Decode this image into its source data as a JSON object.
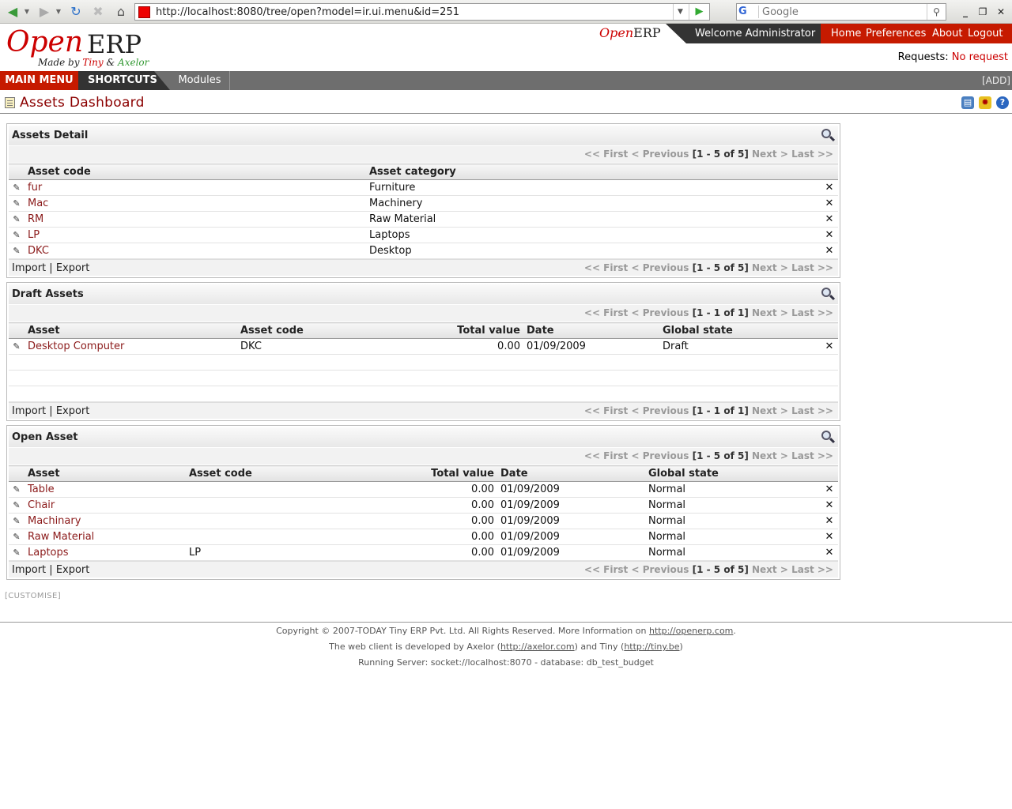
{
  "browser": {
    "url": "http://localhost:8080/tree/open?model=ir.ui.menu&id=251",
    "search_placeholder": "Google",
    "search_engine_icon": "G"
  },
  "header": {
    "logo_open": "Open",
    "logo_erp": "ERP",
    "logo_made_by": "Made by",
    "logo_tiny": "Tiny",
    "logo_amp": "&",
    "logo_axelor": "Axelor",
    "mini_logo_open": "Open",
    "mini_logo_erp": "ERP",
    "welcome": "Welcome Administrator",
    "links": {
      "home": "Home",
      "preferences": "Preferences",
      "about": "About",
      "logout": "Logout"
    },
    "requests_label": "Requests:",
    "requests_value": "No request"
  },
  "menubar": {
    "main_menu": "MAIN MENU",
    "shortcuts": "SHORTCUTS",
    "modules": "Modules",
    "add": "[ADD]"
  },
  "page": {
    "title": "Assets Dashboard"
  },
  "pager_labels": {
    "first": "<< First",
    "previous": "< Previous",
    "next": "Next >",
    "last": "Last >>"
  },
  "import_label": "Import",
  "export_label": "Export",
  "assets_detail": {
    "title": "Assets Detail",
    "pager": "[1 - 5 of 5]",
    "columns": [
      "Asset code",
      "Asset category"
    ],
    "rows": [
      [
        "fur",
        "Furniture"
      ],
      [
        "Mac",
        "Machinery"
      ],
      [
        "RM",
        "Raw Material"
      ],
      [
        "LP",
        "Laptops"
      ],
      [
        "DKC",
        "Desktop"
      ]
    ]
  },
  "draft_assets": {
    "title": "Draft Assets",
    "pager": "[1 - 1 of 1]",
    "columns": [
      "Asset",
      "Asset code",
      "Total value",
      "Date",
      "Global state"
    ],
    "rows": [
      [
        "Desktop Computer",
        "DKC",
        "0.00",
        "01/09/2009",
        "Draft"
      ]
    ]
  },
  "open_asset": {
    "title": "Open Asset",
    "pager": "[1 - 5 of 5]",
    "columns": [
      "Asset",
      "Asset code",
      "Total value",
      "Date",
      "Global state"
    ],
    "rows": [
      [
        "Table",
        "",
        "0.00",
        "01/09/2009",
        "Normal"
      ],
      [
        "Chair",
        "",
        "0.00",
        "01/09/2009",
        "Normal"
      ],
      [
        "Machinary",
        "",
        "0.00",
        "01/09/2009",
        "Normal"
      ],
      [
        "Raw Material",
        "",
        "0.00",
        "01/09/2009",
        "Normal"
      ],
      [
        "Laptops",
        "LP",
        "0.00",
        "01/09/2009",
        "Normal"
      ]
    ]
  },
  "customise": "[CUSTOMISE]",
  "footer": {
    "line1_text": "Copyright © 2007-TODAY Tiny ERP Pvt. Ltd. All Rights Reserved. More Information on",
    "line1_link": "http://openerp.com",
    "line1_end": ".",
    "line2_a": "The web client is developed by Axelor (",
    "line2_link1": "http://axelor.com",
    "line2_b": ") and Tiny (",
    "line2_link2": "http://tiny.be",
    "line2_c": ")",
    "line3": "Running Server: socket://localhost:8070 - database: db_test_budget"
  }
}
